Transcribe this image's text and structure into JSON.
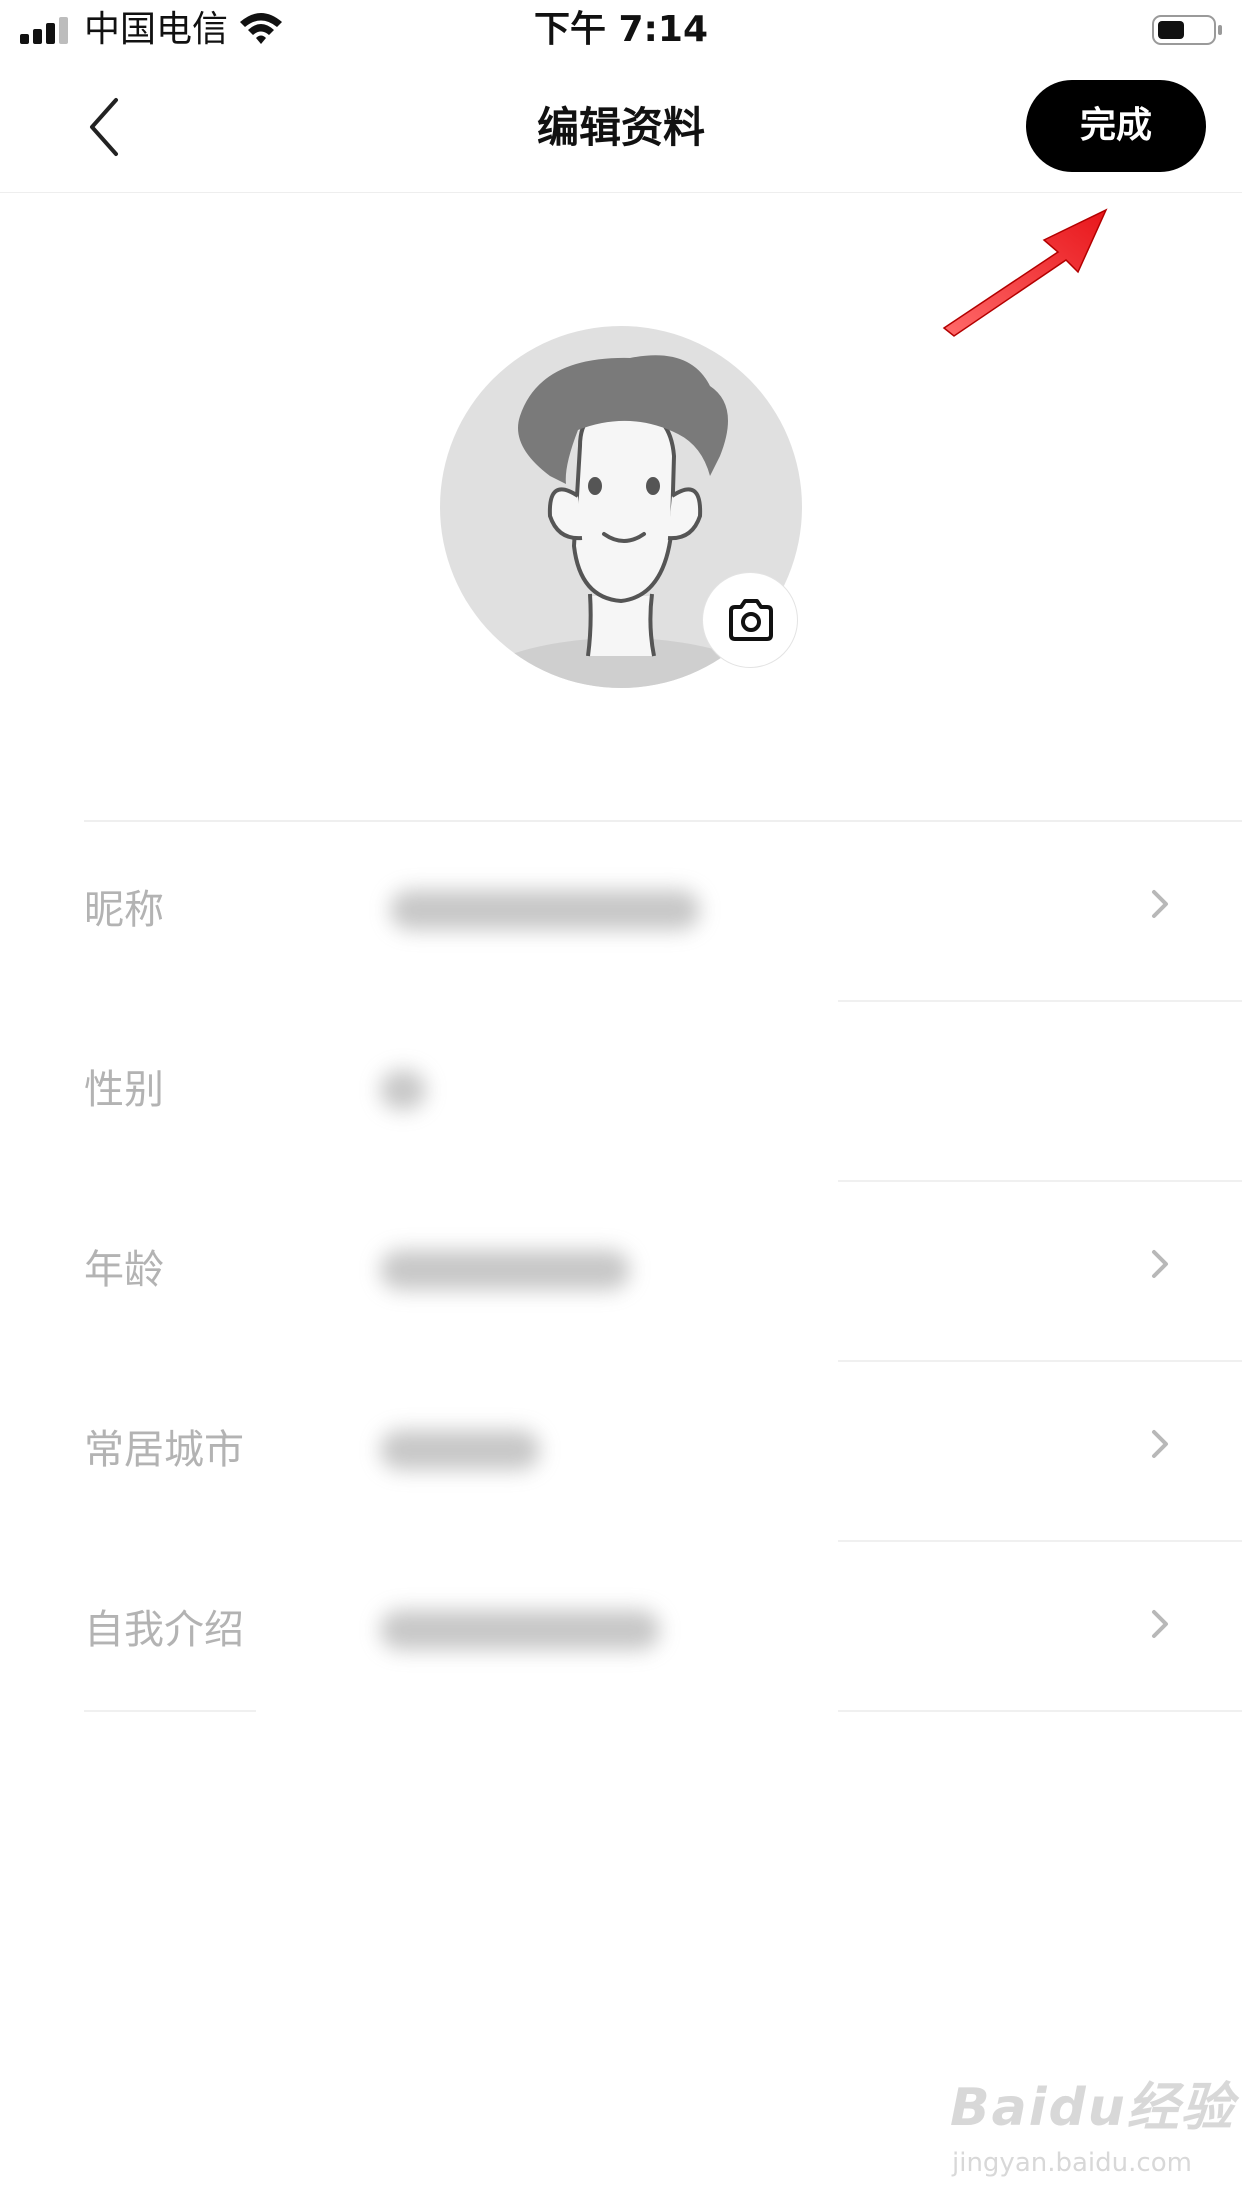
{
  "status_bar": {
    "carrier": "中国电信",
    "time": "下午 7:14"
  },
  "nav": {
    "title": "编辑资料",
    "done_label": "完成"
  },
  "profile_rows": [
    {
      "label": "昵称",
      "has_chevron": true
    },
    {
      "label": "性别",
      "has_chevron": false
    },
    {
      "label": "年龄",
      "has_chevron": true
    },
    {
      "label": "常居城市",
      "has_chevron": true
    },
    {
      "label": "自我介绍",
      "has_chevron": true
    }
  ],
  "watermark": {
    "logo": "Baidu经验",
    "url": "jingyan.baidu.com"
  },
  "colors": {
    "done_button_bg": "#000000",
    "annotation_arrow": "#e8161b",
    "label_text": "#b3b3b3"
  },
  "icons": [
    "signal-icon",
    "wifi-icon",
    "battery-icon",
    "back-arrow-icon",
    "camera-icon",
    "chevron-right-icon"
  ]
}
